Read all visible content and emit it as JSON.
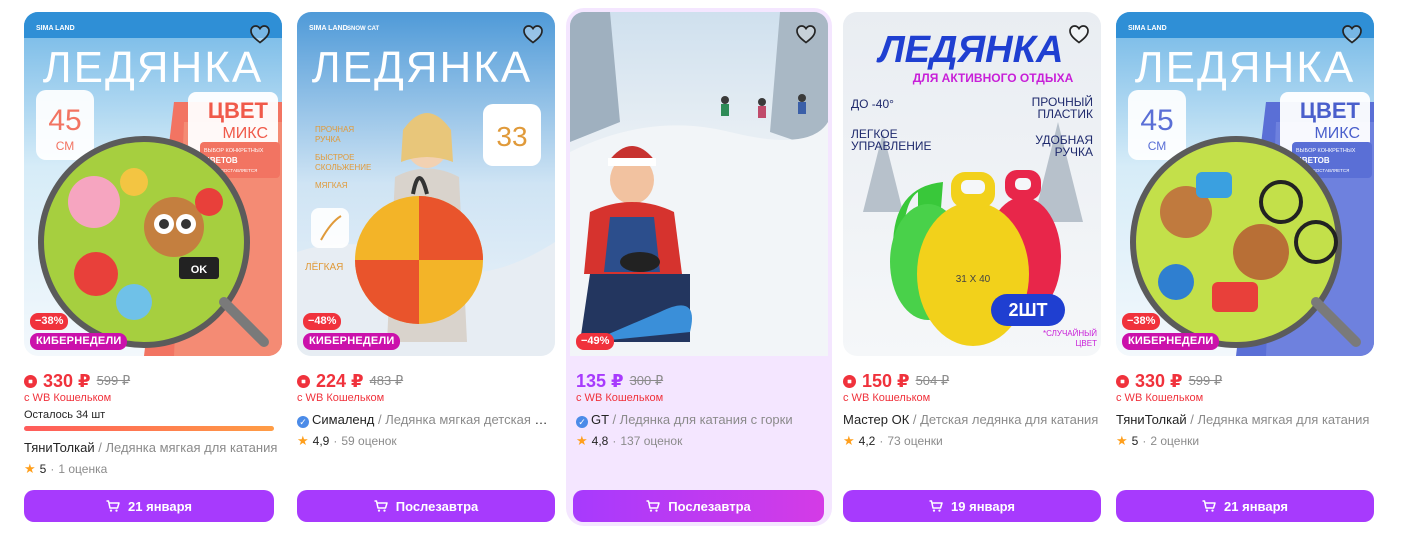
{
  "products": [
    {
      "discount": "−38%",
      "promo": "КИБЕРНЕДЕЛИ",
      "price": "330 ₽",
      "old_price": "599 ₽",
      "wallet_note": "с WB Кошельком",
      "stock_text": "Осталось 34 шт",
      "brand": "ТяниТолкай",
      "separator": " / ",
      "name": "Ледянка мягкая для катания",
      "rating": "5",
      "dot": "·",
      "reviews": "1 оценка",
      "button": "21 января",
      "image": {
        "logo": "SIMA LAND",
        "banner": "ЛЕДЯНКА",
        "size_value": "45",
        "size_unit": "СМ",
        "color_title": "ЦВЕТ",
        "color_sub": "МИКС",
        "note_1": "ВЫБОР КОНКРЕТНЫХ",
        "note_2": "ЦВЕТОВ",
        "note_3": "НЕ ПРЕДОСТАВЛЯЕТСЯ",
        "patch": "OK",
        "accent": "#f26b5b"
      }
    },
    {
      "discount": "−48%",
      "promo": "КИБЕРНЕДЕЛИ",
      "price": "224 ₽",
      "old_price": "483 ₽",
      "wallet_note": "с WB Кошельком",
      "brand": "Сималенд",
      "separator": " / ",
      "name": "Ледянка мягкая детская для катания",
      "rating": "4,9",
      "dot": "·",
      "reviews": "59 оценок",
      "button": "Послезавтра",
      "image": {
        "logo": "SIMA LAND",
        "logo2": "SNOW CAT",
        "banner": "ЛЕДЯНКА",
        "size_value": "33",
        "feat_1": "ПРОЧНАЯ",
        "feat_1b": "РУЧКА",
        "feat_2": "БЫСТРОЕ",
        "feat_2b": "СКОЛЬЖЕНИЕ",
        "feat_3": "МЯГКАЯ",
        "light": "ЛЁГКАЯ"
      }
    },
    {
      "discount": "−49%",
      "price": "135 ₽",
      "old_price": "300 ₽",
      "wallet_note": "с WB Кошельком",
      "brand": "GT",
      "separator": " / ",
      "name": "Ледянка для катания с горки",
      "rating": "4,8",
      "dot": "·",
      "reviews": "137 оценок",
      "button": "Послезавтра"
    },
    {
      "price": "150 ₽",
      "old_price": "504 ₽",
      "wallet_note": "с WB Кошельком",
      "brand": "Мастер ОК",
      "separator": " / ",
      "name": "Детская ледянка для катания",
      "rating": "4,2",
      "dot": "·",
      "reviews": "73 оценки",
      "button": "19 января",
      "image": {
        "banner": "ЛЕДЯНКА",
        "sub": "ДЛЯ АКТИВНОГО ОТДЫХА",
        "f1": "ДО -40°",
        "f2a": "ПРОЧНЫЙ",
        "f2b": "ПЛАСТИК",
        "f3a": "ЛЕГКОЕ",
        "f3b": "УПРАВЛЕНИЕ",
        "f4a": "УДОБНАЯ",
        "f4b": "РУЧКА",
        "dims": "31 X 40",
        "qty": "2ШТ",
        "note_a": "*СЛУЧАЙНЫЙ",
        "note_b": "ЦВЕТ"
      }
    },
    {
      "discount": "−38%",
      "promo": "КИБЕРНЕДЕЛИ",
      "price": "330 ₽",
      "old_price": "599 ₽",
      "wallet_note": "с WB Кошельком",
      "brand": "ТяниТолкай",
      "separator": " / ",
      "name": "Ледянка мягкая для катания",
      "rating": "5",
      "dot": "·",
      "reviews": "2 оценки",
      "button": "21 января",
      "image": {
        "logo": "SIMA LAND",
        "banner": "ЛЕДЯНКА",
        "size_value": "45",
        "size_unit": "СМ",
        "color_title": "ЦВЕТ",
        "color_sub": "МИКС",
        "note_1": "ВЫБОР КОНКРЕТНЫХ",
        "note_2": "ЦВЕТОВ",
        "note_3": "НЕ ПРЕДОСТАВЛЯЕТСЯ",
        "accent": "#5a6fd6"
      }
    }
  ],
  "colors": {
    "accent_violet": "#a73afd",
    "price_red": "#f0323c",
    "promo_magenta": "#cb11ab",
    "highlight_bg": "#f4e6ff"
  },
  "icons": {
    "favorite": "heart-outline-icon",
    "cart": "cart-icon",
    "star": "star-icon",
    "wallet": "wallet-icon",
    "verified": "verified-check-icon"
  }
}
